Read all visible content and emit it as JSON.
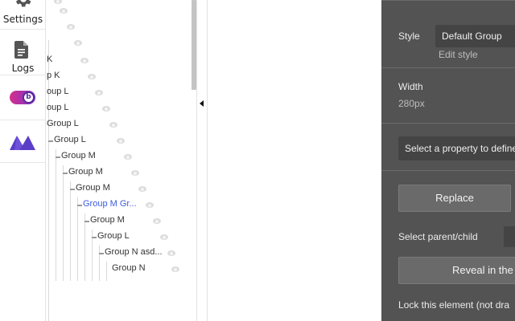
{
  "rail": {
    "settings_label": "Settings",
    "logs_label": "Logs",
    "items": [
      {
        "name": "settings",
        "icon": "gear-icon"
      },
      {
        "name": "logs",
        "icon": "document-icon"
      },
      {
        "name": "plugin",
        "icon": "toggle-plugin-icon",
        "badge": "b"
      },
      {
        "name": "bubble",
        "icon": "bubble-logo-icon"
      }
    ]
  },
  "tree": {
    "rows": [
      {
        "label": "K",
        "level": 0
      },
      {
        "label": "p K",
        "level": 0
      },
      {
        "label": "oup L",
        "level": 0
      },
      {
        "label": "oup L",
        "level": 0
      },
      {
        "label": "Group L",
        "level": 0
      },
      {
        "label": "Group L",
        "level": 1
      },
      {
        "label": "Group M",
        "level": 2
      },
      {
        "label": "Group M",
        "level": 3
      },
      {
        "label": "Group M",
        "level": 4
      },
      {
        "label": "Group M Gr...",
        "level": 5,
        "selected": true
      },
      {
        "label": "Group M",
        "level": 6
      },
      {
        "label": "Group L",
        "level": 7
      },
      {
        "label": "Group N asd...",
        "level": 8
      },
      {
        "label": "Group N",
        "level": 9
      }
    ]
  },
  "panel": {
    "style_label": "Style",
    "style_value": "Default Group",
    "edit_style": "Edit style",
    "width_label": "Width",
    "width_value": "280px",
    "property_placeholder": "Select a property to define",
    "replace_button": "Replace",
    "select_parent_label": "Select parent/child",
    "reveal_button": "Reveal in the",
    "lock_label": "Lock this element (not dra"
  },
  "colors": {
    "panel_bg": "#535353",
    "selected_text": "#3b5bdb",
    "bubble_purple": "#5b3ec8"
  }
}
